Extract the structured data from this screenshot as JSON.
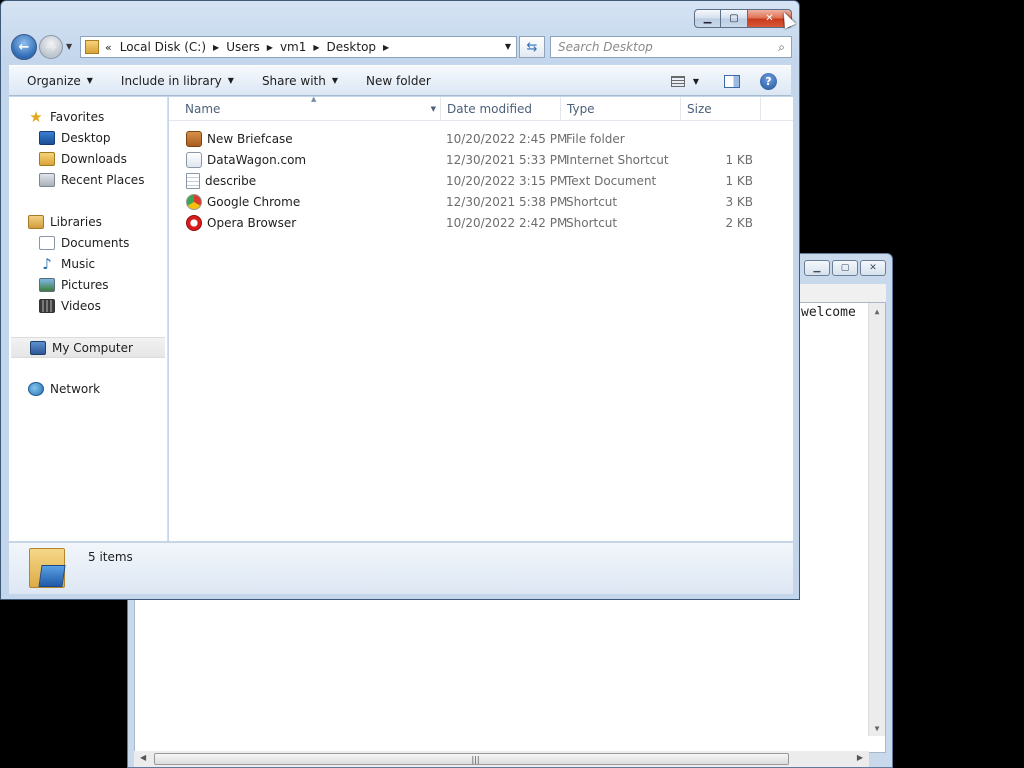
{
  "explorer": {
    "address": {
      "chevrons": "«",
      "segments": [
        "Local Disk (C:)",
        "Users",
        "vm1",
        "Desktop"
      ]
    },
    "search": {
      "placeholder": "Search Desktop"
    },
    "toolbar": {
      "organize": "Organize",
      "include_in_library": "Include in library",
      "share_with": "Share with",
      "new_folder": "New folder"
    },
    "nav": {
      "favorites": {
        "label": "Favorites",
        "items": [
          "Desktop",
          "Downloads",
          "Recent Places"
        ]
      },
      "libraries": {
        "label": "Libraries",
        "items": [
          "Documents",
          "Music",
          "Pictures",
          "Videos"
        ]
      },
      "computer": "My Computer",
      "network": "Network"
    },
    "columns": {
      "name": "Name",
      "date": "Date modified",
      "type": "Type",
      "size": "Size"
    },
    "files": [
      {
        "name": "New Briefcase",
        "date": "10/20/2022 2:45 PM",
        "type": "File folder",
        "size": "",
        "icon": "briefcase-icon"
      },
      {
        "name": "DataWagon.com",
        "date": "12/30/2021 5:33 PM",
        "type": "Internet Shortcut",
        "size": "1 KB",
        "icon": "internet-shortcut-icon"
      },
      {
        "name": "describe",
        "date": "10/20/2022 3:15 PM",
        "type": "Text Document",
        "size": "1 KB",
        "icon": "text-document-icon"
      },
      {
        "name": "Google Chrome",
        "date": "12/30/2021 5:38 PM",
        "type": "Shortcut",
        "size": "3 KB",
        "icon": "chrome-icon"
      },
      {
        "name": "Opera Browser",
        "date": "10/20/2022 2:42 PM",
        "type": "Shortcut",
        "size": "2 KB",
        "icon": "opera-icon"
      }
    ],
    "status": {
      "count": "5 items"
    }
  },
  "background_window": {
    "text": "welcome"
  }
}
